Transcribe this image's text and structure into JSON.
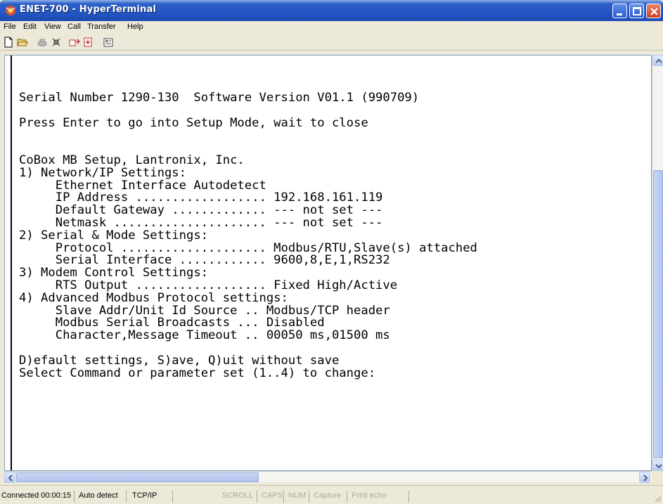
{
  "window": {
    "title": "ENET-700 - HyperTerminal"
  },
  "menu": {
    "items": [
      "File",
      "Edit",
      "View",
      "Call",
      "Transfer",
      "Help"
    ]
  },
  "toolbar": {
    "icons": [
      "new-icon",
      "open-icon",
      "connect-icon",
      "disconnect-icon",
      "send-icon",
      "receive-icon",
      "properties-icon"
    ]
  },
  "terminal": {
    "text": "Serial Number 1290-130  Software Version V01.1 (990709)\n\nPress Enter to go into Setup Mode, wait to close\n\n\nCoBox MB Setup, Lantronix, Inc.\n1) Network/IP Settings:\n     Ethernet Interface Autodetect\n     IP Address .................. 192.168.161.119\n     Default Gateway ............. --- not set ---\n     Netmask ..................... --- not set ---\n2) Serial & Mode Settings:\n     Protocol .................... Modbus/RTU,Slave(s) attached\n     Serial Interface ............ 9600,8,E,1,RS232\n3) Modem Control Settings:\n     RTS Output .................. Fixed High/Active\n4) Advanced Modbus Protocol settings:\n     Slave Addr/Unit Id Source .. Modbus/TCP header\n     Modbus Serial Broadcasts ... Disabled\n     Character,Message Timeout .. 00050 ms,01500 ms\n\nD)efault settings, S)ave, Q)uit without save\nSelect Command or parameter set (1..4) to change:"
  },
  "status": {
    "connected": "Connected 00:00:15",
    "detect": "Auto detect",
    "protocol": "TCP/IP",
    "scroll": "SCROLL",
    "caps": "CAPS",
    "num": "NUM",
    "capture": "Capture",
    "print_echo": "Print echo"
  },
  "colors": {
    "titlebar": "#2457c5",
    "chrome": "#ece9d8",
    "terminal_bg": "#ffffff",
    "close_button": "#c9401e"
  }
}
